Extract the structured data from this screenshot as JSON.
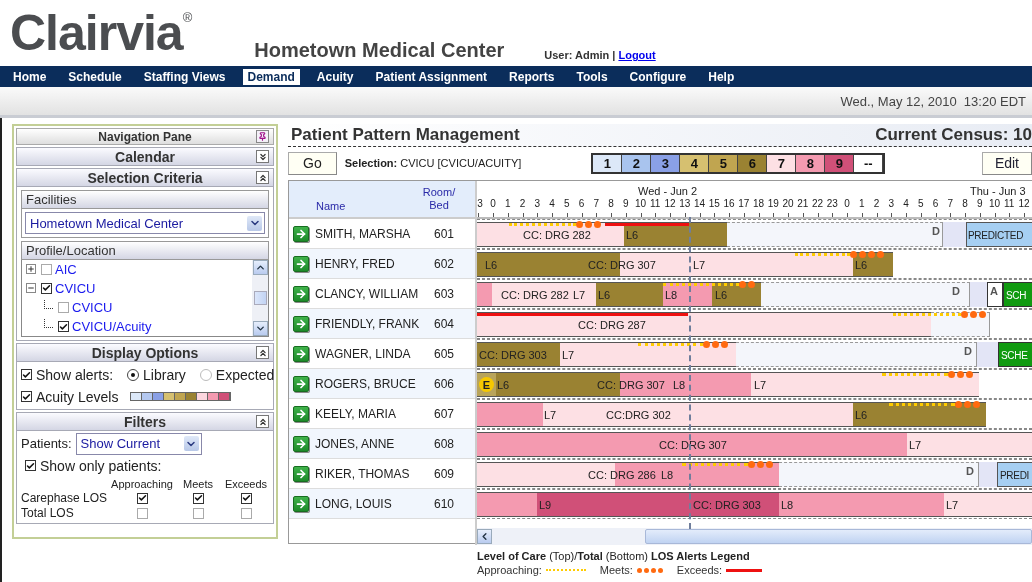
{
  "header": {
    "logo": "Clairvia",
    "logo_mark": "®",
    "facility": "Hometown Medical Center",
    "user": "User: Admin |",
    "logout": "Logout"
  },
  "nav": [
    {
      "label": "Home",
      "selected": false
    },
    {
      "label": "Schedule",
      "selected": false
    },
    {
      "label": "Staffing Views",
      "selected": false
    },
    {
      "label": "Demand",
      "selected": true
    },
    {
      "label": "Acuity",
      "selected": false
    },
    {
      "label": "Patient Assignment",
      "selected": false
    },
    {
      "label": "Reports",
      "selected": false
    },
    {
      "label": "Tools",
      "selected": false
    },
    {
      "label": "Configure",
      "selected": false
    },
    {
      "label": "Help",
      "selected": false
    }
  ],
  "datetime": "Wed., May 12, 2010  13:20 EDT",
  "navigation_pane": {
    "title": "Navigation Pane",
    "calendar": {
      "title": "Calendar",
      "expanded": false
    },
    "selection_criteria": {
      "title": "Selection Criteria",
      "expanded": true,
      "facilities_label": "Facilities",
      "facility": "Hometown Medical Center",
      "profile_label": "Profile/Location",
      "tree": [
        {
          "label": "AIC",
          "expanded": false,
          "checked": false
        },
        {
          "label": "CVICU",
          "expanded": true,
          "checked": true,
          "children": [
            {
              "label": "CVICU",
              "checked": false
            },
            {
              "label": "CVICU/Acuity",
              "checked": true
            }
          ]
        }
      ]
    },
    "display_options": {
      "title": "Display Options",
      "expanded": true,
      "show_alerts": {
        "label": "Show alerts:",
        "checked": true
      },
      "alert_source": [
        {
          "label": "Library",
          "selected": true
        },
        {
          "label": "Expected",
          "selected": false
        }
      ],
      "acuity_levels": {
        "label": "Acuity Levels",
        "checked": true,
        "swatches": [
          {
            "color": "#dce8f8"
          },
          {
            "color": "#b4c8f0"
          },
          {
            "color": "#8aa0e6"
          },
          {
            "color": "#d6c070"
          },
          {
            "color": "#c0a550"
          },
          {
            "color": "#9a8232"
          },
          {
            "color": "#fcd6de"
          },
          {
            "color": "#f49ab0"
          },
          {
            "color": "#d05078"
          }
        ]
      }
    },
    "filters": {
      "title": "Filters",
      "expanded": true,
      "patients_label": "Patients:",
      "patients_value": "Show Current",
      "show_only": {
        "label": "Show only patients:",
        "checked": true
      },
      "columns": [
        "Approaching",
        "Meets",
        "Exceeds"
      ],
      "rows": [
        {
          "label": "Carephase LOS",
          "checks": [
            {
              "checked": true
            },
            {
              "checked": true
            },
            {
              "checked": true
            }
          ]
        },
        {
          "label": "Total LOS",
          "checks": [
            {
              "checked": false
            },
            {
              "checked": false
            },
            {
              "checked": false
            }
          ]
        }
      ]
    }
  },
  "main": {
    "title": "Patient Pattern Management",
    "census": "Current Census: 10",
    "go": "Go",
    "selection_label": "Selection:",
    "selection": "CVICU [CVICU/ACUITY]",
    "acuity_keys": [
      {
        "label": "1",
        "color": "#dce8f8"
      },
      {
        "label": "2",
        "color": "#a9c4ee"
      },
      {
        "label": "3",
        "color": "#8aa0e6"
      },
      {
        "label": "4",
        "color": "#d6c070"
      },
      {
        "label": "5",
        "color": "#c0a550"
      },
      {
        "label": "6",
        "color": "#9a8232"
      },
      {
        "label": "7",
        "color": "#fde0e4"
      },
      {
        "label": "8",
        "color": "#f49ab0"
      },
      {
        "label": "9",
        "color": "#d05078"
      },
      {
        "label": "--",
        "color": "#ffffff"
      }
    ],
    "edit": "Edit",
    "columns": {
      "name": "Name",
      "room": "Room/\nBed"
    },
    "timeline": {
      "days": [
        "Wed - Jun 2",
        "Thu - Jun 3"
      ],
      "hours": [
        "3",
        "0",
        "1",
        "2",
        "3",
        "4",
        "5",
        "6",
        "7",
        "8",
        "9",
        "10",
        "11",
        "12",
        "13",
        "14",
        "15",
        "16",
        "17",
        "18",
        "19",
        "20",
        "21",
        "22",
        "23",
        "0",
        "1",
        "2",
        "3",
        "4",
        "5",
        "6",
        "7",
        "8",
        "9",
        "10",
        "11",
        "12"
      ]
    },
    "patients": [
      {
        "name": "SMITH, MARSHA",
        "room": "601",
        "segments": [
          {
            "kind": "stay",
            "color": "#fde0e4"
          },
          {
            "kind": "stay",
            "color": "#9a8232"
          },
          {
            "kind": "projected"
          },
          {
            "kind": "gap"
          },
          {
            "kind": "predicted"
          }
        ],
        "labels": [
          {
            "text": "CC: DRG 282",
            "kind": "plain"
          },
          {
            "text": "L6",
            "kind": "plain"
          },
          {
            "text": "D",
            "kind": "marker"
          },
          {
            "text": "PREDICTED",
            "kind": "edge"
          }
        ],
        "alerts": [
          {
            "kind": "approaching"
          },
          {
            "kind": "meets"
          },
          {
            "kind": "exceeds"
          }
        ]
      },
      {
        "name": "HENRY, FRED",
        "room": "602",
        "segments": [
          {
            "kind": "stay",
            "color": "#9a8232"
          },
          {
            "kind": "stay",
            "color": "#fde0e4"
          },
          {
            "kind": "stay",
            "color": "#9a8232"
          }
        ],
        "labels": [
          {
            "text": "L6",
            "kind": "plain"
          },
          {
            "text": "CC: DRG 307",
            "kind": "plain"
          },
          {
            "text": "L7",
            "kind": "plain"
          },
          {
            "text": "L6",
            "kind": "plain"
          }
        ],
        "alerts": [
          {
            "kind": "approaching"
          },
          {
            "kind": "meets"
          }
        ]
      },
      {
        "name": "CLANCY, WILLIAM",
        "room": "603",
        "segments": [
          {
            "kind": "stay",
            "color": "#f49ab0"
          },
          {
            "kind": "stay",
            "color": "#fde0e4"
          },
          {
            "kind": "stay",
            "color": "#9a8232"
          },
          {
            "kind": "stay",
            "color": "#f49ab0"
          },
          {
            "kind": "stay",
            "color": "#9a8232"
          },
          {
            "kind": "projected"
          },
          {
            "kind": "gap"
          },
          {
            "kind": "admit"
          },
          {
            "kind": "scheduled"
          }
        ],
        "labels": [
          {
            "text": "CC: DRG 282",
            "kind": "plain"
          },
          {
            "text": "L7",
            "kind": "plain"
          },
          {
            "text": "L6",
            "kind": "plain"
          },
          {
            "text": "L8",
            "kind": "plain"
          },
          {
            "text": "L6",
            "kind": "plain"
          },
          {
            "text": "D",
            "kind": "marker"
          },
          {
            "text": "A",
            "kind": "marker"
          },
          {
            "text": "SCH",
            "kind": "edge_inverse"
          }
        ],
        "alerts": [
          {
            "kind": "approaching"
          },
          {
            "kind": "meets"
          }
        ]
      },
      {
        "name": "FRIENDLY, FRANK",
        "room": "604",
        "segments": [
          {
            "kind": "stay",
            "color": "#fde0e4"
          },
          {
            "kind": "projected"
          }
        ],
        "labels": [
          {
            "text": "CC: DRG 287",
            "kind": "plain"
          }
        ],
        "alerts": [
          {
            "kind": "exceeds"
          },
          {
            "kind": "approaching"
          },
          {
            "kind": "meets"
          }
        ]
      },
      {
        "name": "WAGNER, LINDA",
        "room": "605",
        "segments": [
          {
            "kind": "stay",
            "color": "#9a8232"
          },
          {
            "kind": "stay",
            "color": "#fde0e4"
          },
          {
            "kind": "projected"
          },
          {
            "kind": "gap"
          },
          {
            "kind": "scheduled"
          }
        ],
        "labels": [
          {
            "text": "CC: DRG 303",
            "kind": "plain"
          },
          {
            "text": "L7",
            "kind": "plain"
          },
          {
            "text": "D",
            "kind": "marker"
          },
          {
            "text": "SCHE",
            "kind": "edge_inverse"
          }
        ],
        "alerts": [
          {
            "kind": "approaching"
          },
          {
            "kind": "meets"
          }
        ]
      },
      {
        "name": "ROGERS, BRUCE",
        "room": "606",
        "segments": [
          {
            "kind": "stay",
            "color": "#b9a45a"
          },
          {
            "kind": "stay",
            "color": "#9a8232"
          },
          {
            "kind": "stay",
            "color": "#f49ab0"
          },
          {
            "kind": "stay",
            "color": "#fde0e4"
          }
        ],
        "labels": [
          {
            "text": "E",
            "kind": "badge"
          },
          {
            "text": "L6",
            "kind": "plain"
          },
          {
            "text": "CC: DRG 307",
            "kind": "plain"
          },
          {
            "text": "L8",
            "kind": "plain"
          },
          {
            "text": "L7",
            "kind": "plain"
          }
        ],
        "alerts": [
          {
            "kind": "approaching"
          },
          {
            "kind": "meets"
          }
        ]
      },
      {
        "name": "KEELY, MARIA",
        "room": "607",
        "segments": [
          {
            "kind": "stay",
            "color": "#f49ab0"
          },
          {
            "kind": "stay",
            "color": "#fde0e4"
          },
          {
            "kind": "stay",
            "color": "#9a8232"
          }
        ],
        "labels": [
          {
            "text": "L7",
            "kind": "plain"
          },
          {
            "text": "CC:DRG 302",
            "kind": "plain"
          },
          {
            "text": "L6",
            "kind": "plain"
          }
        ],
        "alerts": [
          {
            "kind": "approaching"
          },
          {
            "kind": "meets"
          }
        ]
      },
      {
        "name": "JONES, ANNE",
        "room": "608",
        "segments": [
          {
            "kind": "stay",
            "color": "#f49ab0"
          },
          {
            "kind": "stay",
            "color": "#fde0e4"
          }
        ],
        "labels": [
          {
            "text": "CC: DRG 307",
            "kind": "plain"
          },
          {
            "text": "L7",
            "kind": "plain"
          }
        ]
      },
      {
        "name": "RIKER, THOMAS",
        "room": "609",
        "segments": [
          {
            "kind": "stay",
            "color": "#fde0e4"
          },
          {
            "kind": "stay",
            "color": "#f49ab0"
          },
          {
            "kind": "projected"
          },
          {
            "kind": "gap"
          },
          {
            "kind": "predicted"
          }
        ],
        "labels": [
          {
            "text": "CC: DRG 286",
            "kind": "plain"
          },
          {
            "text": "L8",
            "kind": "plain"
          },
          {
            "text": "D",
            "kind": "marker"
          },
          {
            "text": "PREDI",
            "kind": "edge"
          }
        ],
        "alerts": [
          {
            "kind": "approaching"
          },
          {
            "kind": "meets"
          }
        ]
      },
      {
        "name": "LONG, LOUIS",
        "room": "610",
        "segments": [
          {
            "kind": "stay",
            "color": "#f49ab0"
          },
          {
            "kind": "stay",
            "color": "#d05078"
          },
          {
            "kind": "stay",
            "color": "#f49ab0"
          },
          {
            "kind": "stay",
            "color": "#fde0e4"
          }
        ],
        "labels": [
          {
            "text": "L9",
            "kind": "plain"
          },
          {
            "text": "CC: DRG 303",
            "kind": "plain"
          },
          {
            "text": "L8",
            "kind": "plain"
          },
          {
            "text": "L7",
            "kind": "plain"
          }
        ]
      }
    ],
    "legend": {
      "title": "**Level of Care** (Top)/**Total** (Bottom) **LOS Alerts Legend**",
      "items": [
        {
          "kind": "approaching",
          "label": "Approaching:"
        },
        {
          "kind": "meets",
          "label": "Meets:"
        },
        {
          "kind": "exceeds",
          "label": "Exceeds:"
        }
      ]
    }
  }
}
